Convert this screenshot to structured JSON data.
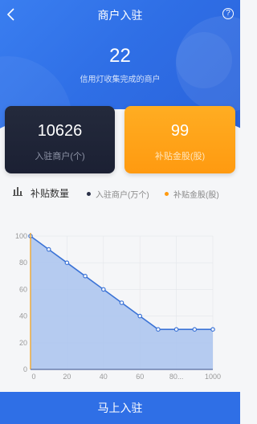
{
  "navbar": {
    "title": "商户入驻",
    "back_icon": "chevron-left-icon",
    "help_icon": "question-circle-icon",
    "help_glyph": "?"
  },
  "hero": {
    "count": "22",
    "caption": "信用灯收集完成的商户"
  },
  "cards": {
    "merchants": {
      "value": "10626",
      "label": "入驻商户(个)"
    },
    "subsidy": {
      "value": "99",
      "label": "补贴金股(股)"
    }
  },
  "legend": {
    "title": "补贴数量",
    "icon": "bar-chart-icon",
    "items": [
      {
        "label": "入驻商户(万个)",
        "color": "#2b3148"
      },
      {
        "label": "补贴金股(股)",
        "color": "#ff9a10"
      }
    ]
  },
  "chart_data": {
    "type": "area",
    "x_tick_labels": [
      "0",
      "20",
      "40",
      "60",
      "80...",
      "1000"
    ],
    "y_ticks": [
      0,
      20,
      40,
      60,
      80,
      100
    ],
    "ylim": [
      0,
      100
    ],
    "points": [
      {
        "x": 0,
        "y": 100
      },
      {
        "x": 10,
        "y": 90
      },
      {
        "x": 20,
        "y": 80
      },
      {
        "x": 30,
        "y": 70
      },
      {
        "x": 40,
        "y": 60
      },
      {
        "x": 50,
        "y": 50
      },
      {
        "x": 60,
        "y": 40
      },
      {
        "x": 70,
        "y": 30
      },
      {
        "x": 80,
        "y": 30
      },
      {
        "x": 90,
        "y": 30
      },
      {
        "x": 100,
        "y": 30
      }
    ],
    "line_color": "#3b73d6",
    "fill_color": "#a9c3ef"
  },
  "bottom_button": {
    "label": "马上入驻"
  }
}
